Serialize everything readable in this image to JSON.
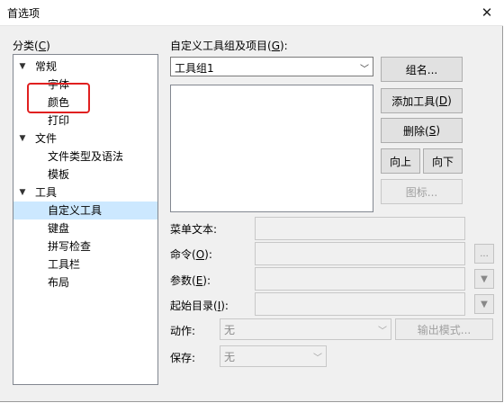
{
  "window": {
    "title": "首选项",
    "close_icon": "close-icon"
  },
  "category": {
    "label_text": "分类(",
    "label_key": "C",
    "label_end": ")",
    "tree": [
      {
        "label": "常规",
        "expanded": true,
        "level": 0
      },
      {
        "label": "字体",
        "level": 1
      },
      {
        "label": "颜色",
        "level": 1
      },
      {
        "label": "打印",
        "level": 1
      },
      {
        "label": "文件",
        "expanded": true,
        "level": 0
      },
      {
        "label": "文件类型及语法",
        "level": 1
      },
      {
        "label": "模板",
        "level": 1
      },
      {
        "label": "工具",
        "expanded": true,
        "level": 0
      },
      {
        "label": "自定义工具",
        "level": 1,
        "selected": true
      },
      {
        "label": "键盘",
        "level": 1
      },
      {
        "label": "拼写检查",
        "level": 1
      },
      {
        "label": "工具栏",
        "level": 1
      },
      {
        "label": "布局",
        "level": 1
      }
    ]
  },
  "tools": {
    "group_label_text": "自定义工具组及项目(",
    "group_label_key": "G",
    "group_label_end": "):",
    "group_select": "工具组1",
    "buttons": {
      "group_name_text": "组名...",
      "add_tool_text": "添加工具(",
      "add_tool_key": "D",
      "add_tool_end": ")",
      "delete_text": "删除(",
      "delete_key": "S",
      "delete_end": ")",
      "up": "向上",
      "down": "向下",
      "icon": "图标..."
    },
    "menu_text_label": "菜单文本:",
    "command_label_text": "命令(",
    "command_label_key": "O",
    "command_label_end": "):",
    "command_browse": "...",
    "params_label_text": "参数(",
    "params_label_key": "E",
    "params_label_end": "):",
    "startdir_label_text": "起始目录(",
    "startdir_label_key": "I",
    "startdir_label_end": "):",
    "action_label": "动作:",
    "action_value": "无",
    "output_mode": "输出模式...",
    "save_label": "保存:",
    "save_value": "无"
  },
  "colors": {
    "highlight": "#e02020",
    "selected_bg": "#cce8ff"
  }
}
